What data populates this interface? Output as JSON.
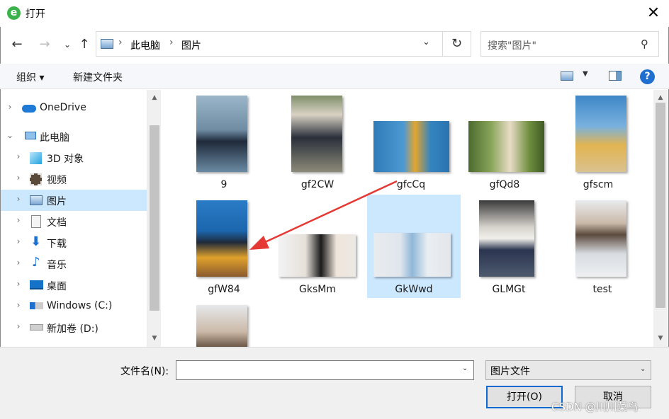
{
  "window": {
    "title": "打开",
    "app_icon": "e",
    "close": "✕"
  },
  "address": {
    "crumbs": [
      "此电脑",
      "图片"
    ],
    "search_placeholder": "搜索\"图片\""
  },
  "toolbar": {
    "organize": "组织 ▾",
    "new_folder": "新建文件夹",
    "help": "?"
  },
  "nav": {
    "items": [
      {
        "label": "OneDrive",
        "icon": "cloud-icon"
      },
      {
        "label": "此电脑",
        "icon": "computer-icon"
      },
      {
        "label": "3D 对象",
        "icon": "cube-icon"
      },
      {
        "label": "视频",
        "icon": "video-icon"
      },
      {
        "label": "图片",
        "icon": "picture-icon",
        "selected": true
      },
      {
        "label": "文档",
        "icon": "document-icon"
      },
      {
        "label": "下载",
        "icon": "download-icon"
      },
      {
        "label": "音乐",
        "icon": "music-icon"
      },
      {
        "label": "桌面",
        "icon": "desktop-icon"
      },
      {
        "label": "Windows (C:)",
        "icon": "drive-icon"
      },
      {
        "label": "新加卷 (D:)",
        "icon": "drive-icon"
      }
    ]
  },
  "files": [
    {
      "name": "9"
    },
    {
      "name": "gf2CW"
    },
    {
      "name": "gfcCq"
    },
    {
      "name": "gfQd8"
    },
    {
      "name": "gfscm"
    },
    {
      "name": "gfW84"
    },
    {
      "name": "GksMm"
    },
    {
      "name": "GkWwd",
      "selected": true
    },
    {
      "name": "GLMGt"
    },
    {
      "name": "test"
    },
    {
      "name": ""
    }
  ],
  "bottom": {
    "filename_label": "文件名(N):",
    "filename_value": "",
    "filetype": "图片文件",
    "open": "打开(O)",
    "cancel": "取消"
  },
  "watermark": "CSDN @川川菜鸟",
  "colors": {
    "selection": "#cce8ff",
    "accent": "#0a6ad1",
    "arrow": "#e53935"
  }
}
